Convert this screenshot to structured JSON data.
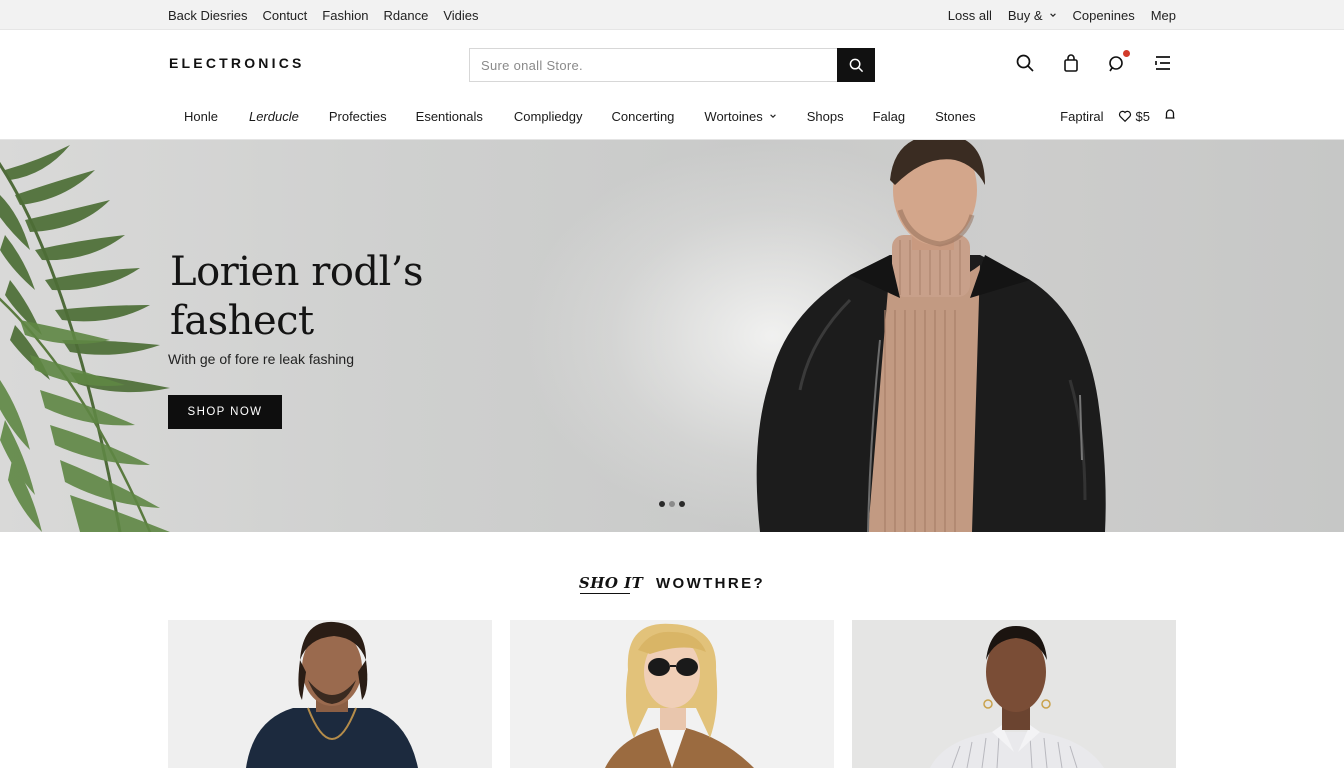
{
  "utility_bar": {
    "left_links": [
      "Back Diesries",
      "Contuct",
      "Fashion",
      "Rdance",
      "Vidies"
    ],
    "right_links": [
      {
        "label": "Loss all",
        "dropdown": false
      },
      {
        "label": "Buy &",
        "dropdown": true
      },
      {
        "label": "Copenines",
        "dropdown": false
      },
      {
        "label": "Mep",
        "dropdown": false
      }
    ]
  },
  "header": {
    "logo": "ELECTRONICS",
    "search_placeholder": "Sure onall Store.",
    "icons": [
      "search-icon",
      "bag-icon",
      "notification-icon",
      "menu-icon"
    ]
  },
  "category_nav": {
    "items": [
      "Honle",
      "Lerducle",
      "Profecties",
      "Esentionals",
      "Compliedgy",
      "Concerting",
      "Wortoines",
      "Shops",
      "Falag",
      "Stones"
    ],
    "dropdown_item": "Wortoines",
    "right_label": "Faptiral",
    "wishlist_label": "$5"
  },
  "hero": {
    "title_line1": "Lorien rodl’s",
    "title_line2": "fashect",
    "subtitle": "With ge of fore re leak fashing",
    "cta_label": "SHOP NOW",
    "slide_count": 3,
    "active_slide": 1
  },
  "section": {
    "title_script": "SHO IT",
    "title_main": "WOWTHRE?"
  },
  "colors": {
    "accent": "#111111",
    "hero_bg": "#cfd0cf",
    "notification": "#d23b2b"
  }
}
